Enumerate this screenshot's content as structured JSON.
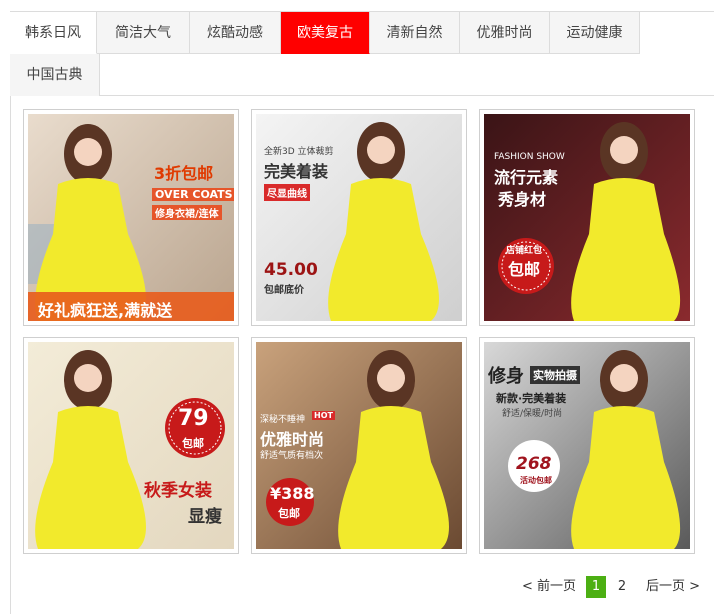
{
  "tabs": [
    {
      "label": "韩系日风"
    },
    {
      "label": "简洁大气"
    },
    {
      "label": "炫酷动感"
    },
    {
      "label": "欧美复古"
    },
    {
      "label": "清新自然"
    },
    {
      "label": "优雅时尚"
    },
    {
      "label": "运动健康"
    },
    {
      "label": "中国古典"
    }
  ],
  "active_tab": "欧美复古",
  "colors": {
    "active_tab": "#ff0000",
    "current_page": "#4caf13",
    "dress": "#f2ea2c"
  },
  "products": [
    {
      "icon": "dress-model-image",
      "lines": [
        "3折包邮",
        "OVER COATS",
        "修身衣裙/连体",
        "好礼疯狂送,满就送"
      ]
    },
    {
      "icon": "dress-model-image",
      "lines": [
        "全新3D 立体裁剪",
        "完美着装",
        "尽显曲线",
        "45.00",
        "包邮底价"
      ]
    },
    {
      "icon": "dress-model-image",
      "lines": [
        "FASHION SHOW",
        "流行元素",
        "秀身材",
        "店铺红包",
        "包邮"
      ]
    },
    {
      "icon": "dress-model-image",
      "lines": [
        "79",
        "包邮",
        "秋季女装",
        "显瘦"
      ]
    },
    {
      "icon": "dress-model-image",
      "lines": [
        "深秘不睡神",
        "HOT",
        "优雅时尚",
        "舒适气质有档次",
        "¥388",
        "包邮"
      ]
    },
    {
      "icon": "dress-model-image",
      "lines": [
        "修身",
        "实物拍摄",
        "新款·完美着装",
        "舒适/保暖/时尚",
        "268",
        "活动包邮"
      ]
    }
  ],
  "pagination": {
    "prev": "< 前一页",
    "pages": [
      "1",
      "2"
    ],
    "current": "1",
    "next": "后一页 >"
  }
}
